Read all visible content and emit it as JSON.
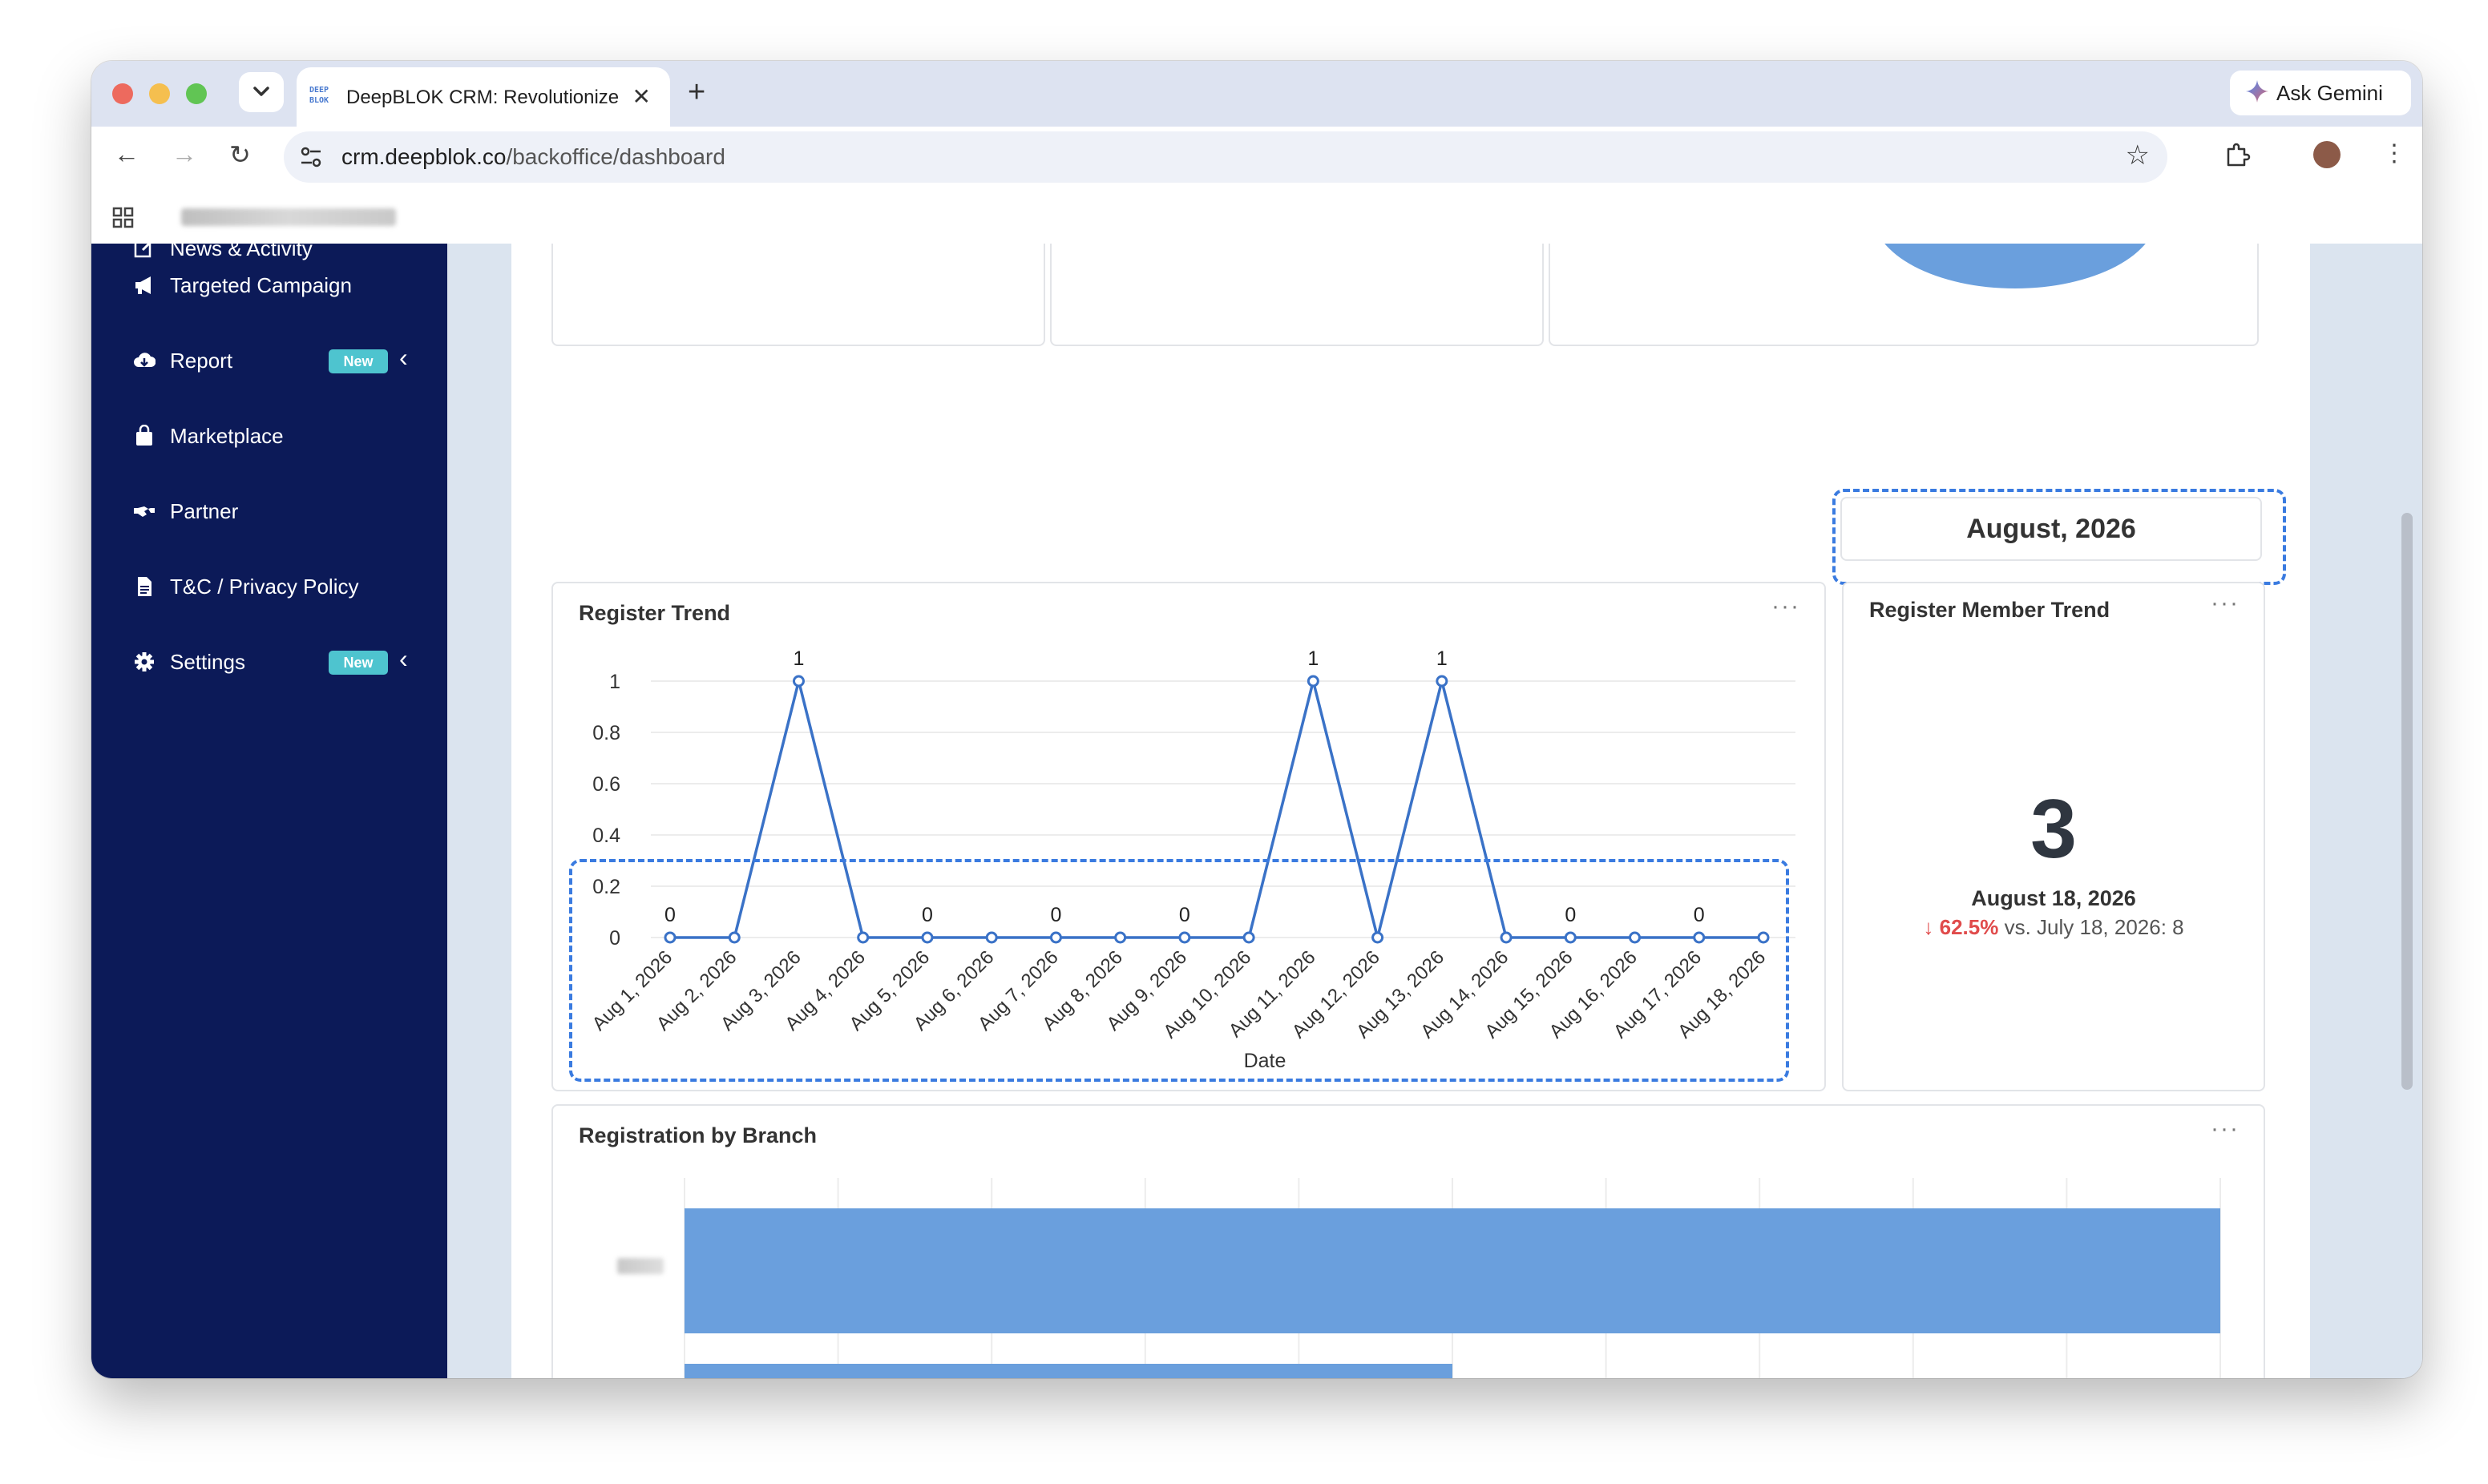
{
  "browser": {
    "tab_title": "DeepBLOK CRM: Revolutionize",
    "tab_favicon_text": "DEEP BLOK",
    "gemini_label": "Ask Gemini",
    "url_host": "crm.deepblok.co",
    "url_path": "/backoffice/dashboard"
  },
  "sidebar": {
    "items": [
      {
        "label": "News & Activity",
        "icon": "edit-icon"
      },
      {
        "label": "Targeted Campaign",
        "icon": "megaphone-icon"
      },
      {
        "label": "Report",
        "icon": "cloud-download-icon",
        "badge": "New"
      },
      {
        "label": "Marketplace",
        "icon": "shopping-bag-icon"
      },
      {
        "label": "Partner",
        "icon": "handshake-icon"
      },
      {
        "label": "T&C / Privacy Policy",
        "icon": "document-icon"
      },
      {
        "label": "Settings",
        "icon": "gear-icon",
        "badge": "New"
      }
    ]
  },
  "date_picker": {
    "value": "August, 2026"
  },
  "register_trend": {
    "title": "Register Trend",
    "more": "···",
    "xlabel": "Date"
  },
  "member_trend": {
    "title": "Register Member Trend",
    "more": "···",
    "value": "3",
    "date": "August 18, 2026",
    "delta_pct": "62.5%",
    "delta_text": "vs. July 18, 2026: 8"
  },
  "branch": {
    "title": "Registration by Branch",
    "more": "···"
  },
  "colors": {
    "sidebar_bg": "#0c1a58",
    "accent": "#3a7be0",
    "bar": "#6a9fdd",
    "badge": "#4ec4cf",
    "negative": "#e04b4b"
  },
  "chart_data": [
    {
      "type": "line",
      "title": "Register Trend",
      "xlabel": "Date",
      "ylabel": "",
      "categories": [
        "Aug 1, 2026",
        "Aug 2, 2026",
        "Aug 3, 2026",
        "Aug 4, 2026",
        "Aug 5, 2026",
        "Aug 6, 2026",
        "Aug 7, 2026",
        "Aug 8, 2026",
        "Aug 9, 2026",
        "Aug 10, 2026",
        "Aug 11, 2026",
        "Aug 12, 2026",
        "Aug 13, 2026",
        "Aug 14, 2026",
        "Aug 15, 2026",
        "Aug 16, 2026",
        "Aug 17, 2026",
        "Aug 18, 2026"
      ],
      "values": [
        0,
        0,
        1,
        0,
        0,
        0,
        0,
        0,
        0,
        0,
        1,
        0,
        1,
        0,
        0,
        0,
        0,
        0
      ],
      "labeled_points": [
        0,
        2,
        4,
        6,
        8,
        10,
        12,
        14,
        16
      ],
      "yticks": [
        "0",
        "0.2",
        "0.4",
        "0.6",
        "0.8",
        "1"
      ],
      "ylim": [
        0,
        1
      ],
      "grid": true,
      "color": "#3a72c7"
    },
    {
      "type": "bar",
      "title": "Registration by Branch",
      "orientation": "horizontal",
      "values": [
        1,
        0.5
      ],
      "color": "#6a9fdd",
      "grid": true
    }
  ]
}
